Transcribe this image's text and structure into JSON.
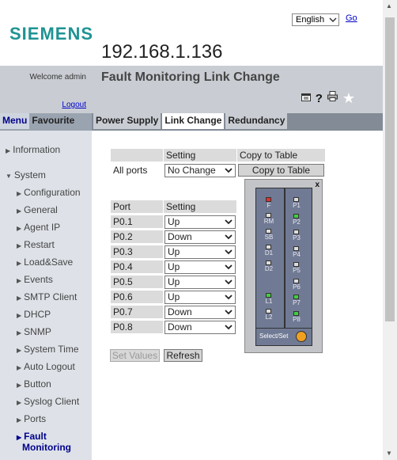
{
  "header": {
    "brand": "SIEMENS",
    "ip": "192.168.1.136",
    "language_selected": "English",
    "go_label": "Go"
  },
  "user": {
    "welcome": "Welcome admin",
    "logout": "Logout"
  },
  "page": {
    "title": "Fault Monitoring Link Change"
  },
  "menu_tabs": [
    {
      "label": "Menu",
      "active": true
    },
    {
      "label": "Favourite",
      "active": false
    }
  ],
  "page_tabs": [
    {
      "label": "Power Supply",
      "active": false
    },
    {
      "label": "Link Change",
      "active": true
    },
    {
      "label": "Redundancy",
      "active": false
    }
  ],
  "nav": [
    {
      "label": "Information",
      "expanded": false
    },
    {
      "label": "System",
      "expanded": true
    },
    {
      "label": "Configuration"
    },
    {
      "label": "General"
    },
    {
      "label": "Agent IP"
    },
    {
      "label": "Restart"
    },
    {
      "label": "Load&Save"
    },
    {
      "label": "Events"
    },
    {
      "label": "SMTP Client"
    },
    {
      "label": "DHCP"
    },
    {
      "label": "SNMP"
    },
    {
      "label": "System Time"
    },
    {
      "label": "Auto Logout"
    },
    {
      "label": "Button"
    },
    {
      "label": "Syslog Client"
    },
    {
      "label": "Ports"
    },
    {
      "label": "Fault",
      "label2": "Monitoring",
      "active": true
    }
  ],
  "all_ports": {
    "header_setting": "Setting",
    "header_copy": "Copy to Table",
    "row_label": "All ports",
    "setting_value": "No Change",
    "copy_button": "Copy to Table"
  },
  "port_table": {
    "header_port": "Port",
    "header_setting": "Setting",
    "rows": [
      {
        "port": "P0.1",
        "setting": "Up"
      },
      {
        "port": "P0.2",
        "setting": "Down"
      },
      {
        "port": "P0.3",
        "setting": "Up"
      },
      {
        "port": "P0.4",
        "setting": "Up"
      },
      {
        "port": "P0.5",
        "setting": "Up"
      },
      {
        "port": "P0.6",
        "setting": "Up"
      },
      {
        "port": "P0.7",
        "setting": "Down"
      },
      {
        "port": "P0.8",
        "setting": "Down"
      }
    ]
  },
  "buttons": {
    "set_values": "Set Values",
    "refresh": "Refresh"
  },
  "device_panel": {
    "close": "x",
    "select_set": "Select/Set",
    "left_leds": [
      {
        "label": "F",
        "state": "red"
      },
      {
        "label": "RM",
        "state": "off"
      },
      {
        "label": "SB",
        "state": "off"
      },
      {
        "label": "D1",
        "state": "off"
      },
      {
        "label": "D2",
        "state": "off"
      },
      {
        "label": "L1",
        "state": "green"
      },
      {
        "label": "L2",
        "state": "off"
      }
    ],
    "right_leds": [
      {
        "label": "P1",
        "state": "off"
      },
      {
        "label": "P2",
        "state": "green"
      },
      {
        "label": "P3",
        "state": "off"
      },
      {
        "label": "P4",
        "state": "off"
      },
      {
        "label": "P5",
        "state": "off"
      },
      {
        "label": "P6",
        "state": "off"
      },
      {
        "label": "P7",
        "state": "green"
      },
      {
        "label": "P8",
        "state": "green"
      }
    ]
  },
  "colors": {
    "brand": "#1f9393",
    "led_red": "#e03030",
    "led_green": "#40d040",
    "select_button": "#f0a020"
  }
}
